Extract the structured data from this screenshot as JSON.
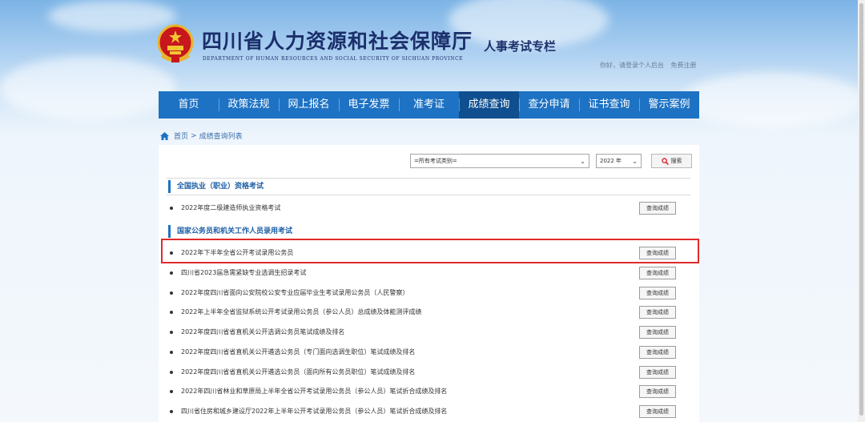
{
  "header": {
    "site_title": "四川省人力资源和社会保障厅",
    "site_subtitle": "DEPARTMENT OF HUMAN RESOURCES AND SOCIAL SECURITY OF SICHUAN PROVINCE",
    "column_title": "人事考试专栏",
    "greeting": "你好，请登录个人后台",
    "register": "免费注册",
    "emblem_icon": "national-emblem-icon"
  },
  "nav": {
    "items": [
      "首页",
      "政策法规",
      "网上报名",
      "电子发票",
      "准考证",
      "成绩查询",
      "查分申请",
      "证书查询",
      "警示案例"
    ],
    "active": "成绩查询"
  },
  "breadcrumb": {
    "home": "首页",
    "sep": ">",
    "current": "成绩查询列表"
  },
  "filter": {
    "category_value": "=所有考试类别=",
    "year_value": "2022 年",
    "search_label": "搜索"
  },
  "sections": [
    {
      "title": "全国执业（职业）资格考试",
      "rows": [
        {
          "text": "2022年度二级建造师执业资格考试",
          "button": "查询成绩"
        }
      ]
    },
    {
      "title": "国家公务员和机关工作人员录用考试",
      "rows": [
        {
          "text": "2022年下半年全省公开考试录用公务员",
          "button": "查询成绩"
        },
        {
          "text": "四川省2023届急需紧缺专业选调生招录考试",
          "button": "查询成绩"
        },
        {
          "text": "2022年度四川省面向公安院校公安专业应届毕业生考试录用公务员（人民警察）",
          "button": "查询成绩"
        },
        {
          "text": "2022年上半年全省监狱系统公开考试录用公务员（参公人员）总成绩及体能测评成绩",
          "button": "查询成绩"
        },
        {
          "text": "2022年度四川省省直机关公开选调公务员笔试成绩及排名",
          "button": "查询成绩"
        },
        {
          "text": "2022年度四川省省直机关公开遴选公务员（专门面向选调生职位）笔试成绩及排名",
          "button": "查询成绩"
        },
        {
          "text": "2022年度四川省省直机关公开遴选公务员（面向所有公务员职位）笔试成绩及排名",
          "button": "查询成绩"
        },
        {
          "text": "2022年四川省林业和草原局上半年全省公开考试录用公务员（参公人员）笔试折合成绩及排名",
          "button": "查询成绩"
        },
        {
          "text": "四川省住房和城乡建设厅2022年上半年公开考试录用公务员（参公人员）笔试折合成绩及排名",
          "button": "查询成绩"
        }
      ]
    }
  ],
  "colors": {
    "nav_bg": "#1d72c4",
    "nav_active": "#0f4f8f",
    "highlight": "#e02a2a",
    "title": "#1b2f6b"
  }
}
